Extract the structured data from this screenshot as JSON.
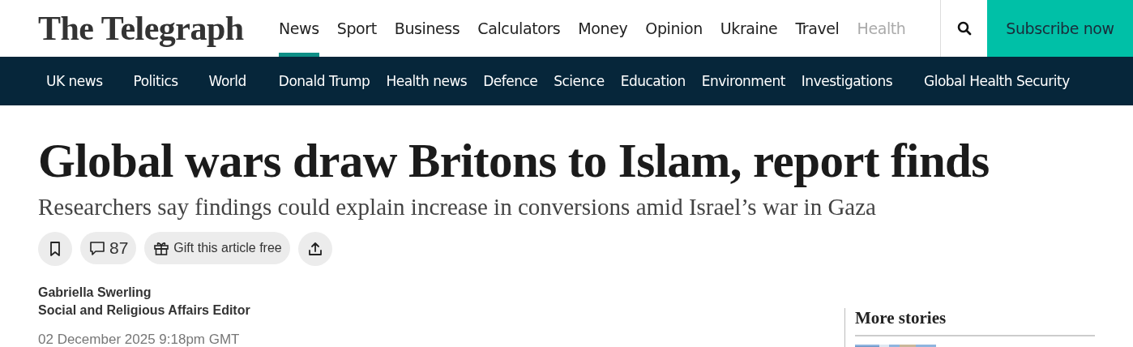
{
  "masthead": {
    "logo": "The Telegraph",
    "nav": [
      {
        "label": "News",
        "selected": true
      },
      {
        "label": "Sport",
        "selected": false
      },
      {
        "label": "Business",
        "selected": false
      },
      {
        "label": "Calculators",
        "selected": false
      },
      {
        "label": "Money",
        "selected": false
      },
      {
        "label": "Opinion",
        "selected": false
      },
      {
        "label": "Ukraine",
        "selected": false
      },
      {
        "label": "Travel",
        "selected": false
      },
      {
        "label": "Health",
        "selected": false,
        "faded": true
      }
    ],
    "subscribe": "Subscribe now"
  },
  "subnav": [
    "UK news",
    "Politics",
    "World",
    "Donald Trump",
    "Health news",
    "Defence",
    "Science",
    "Education",
    "Environment",
    "Investigations",
    "Global Health Security"
  ],
  "article": {
    "headline": "Global wars draw Britons to Islam, report finds",
    "standfirst": "Researchers say findings could explain increase in conversions amid Israel’s war in Gaza",
    "actions": [
      {
        "kind": "save"
      },
      {
        "kind": "comments",
        "label": "87"
      },
      {
        "kind": "gift",
        "label": "Gift this article free"
      },
      {
        "kind": "share"
      }
    ],
    "author": "Gabriella Swerling",
    "role": "Social and Religious Affairs Editor",
    "date": "02 December 2025 9:18pm GMT"
  },
  "sidebar": {
    "title": "More stories"
  }
}
